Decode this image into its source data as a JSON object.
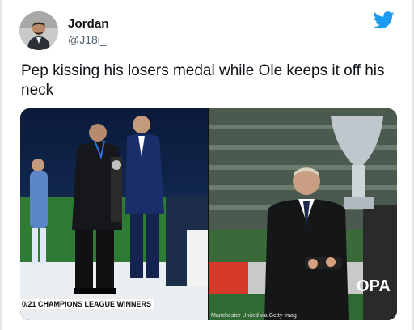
{
  "tweet": {
    "author_name": "Jordan",
    "author_handle": "@J18i_",
    "text": "Pep kissing his losers medal while Ole keeps it off his neck",
    "logo_icon": "twitter-bird-icon",
    "brand_color": "#1d9bf0"
  },
  "media": {
    "left_caption": "0/21 CHAMPIONS LEAGUE WINNERS",
    "right_caption": "Manchester United via Getty Imag"
  }
}
